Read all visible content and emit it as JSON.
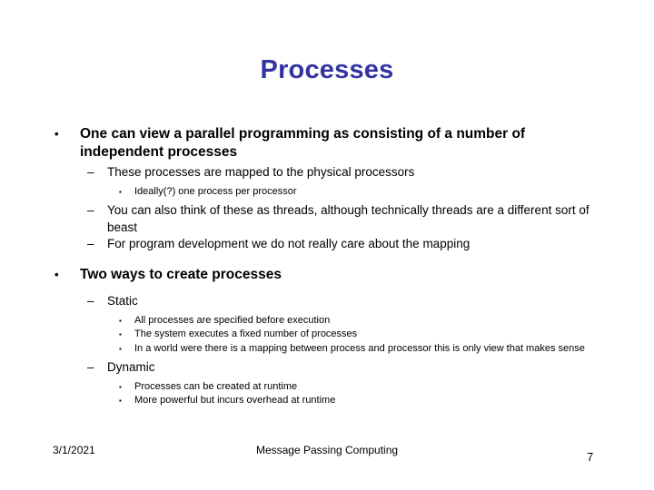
{
  "slide": {
    "title": "Processes",
    "bullets": [
      {
        "level": 1,
        "marker": "•",
        "text": "One can view a parallel programming as consisting of a number of independent processes"
      },
      {
        "level": 2,
        "marker": "–",
        "text": "These processes are mapped to the physical processors"
      },
      {
        "level": 3,
        "marker": "▪",
        "text": "Ideally(?) one process per processor"
      },
      {
        "level": 2,
        "marker": "–",
        "text": "You can also think of these as threads, although technically threads are a different sort of beast"
      },
      {
        "level": 2,
        "marker": "–",
        "text": "For program development we do not really care about the mapping"
      },
      {
        "level": 1,
        "marker": "•",
        "text": "Two ways to create processes"
      },
      {
        "level": 2,
        "marker": "–",
        "text": "Static"
      },
      {
        "level": 3,
        "marker": "▪",
        "text": "All processes are specified before execution"
      },
      {
        "level": 3,
        "marker": "▪",
        "text": "The system executes a fixed number of processes"
      },
      {
        "level": 3,
        "marker": "▪",
        "text": "In a world were there is a mapping between process and processor this is only view that makes sense"
      },
      {
        "level": 2,
        "marker": "–",
        "text": "Dynamic"
      },
      {
        "level": 3,
        "marker": "▪",
        "text": "Processes can be created at runtime"
      },
      {
        "level": 3,
        "marker": "▪",
        "text": "More powerful but incurs overhead at runtime"
      }
    ],
    "footer": {
      "date": "3/1/2021",
      "center": "Message Passing Computing",
      "page_number": "7"
    },
    "colors": {
      "title": "#3333A3",
      "body_text": "#000000",
      "background": "#FFFFFF"
    }
  }
}
